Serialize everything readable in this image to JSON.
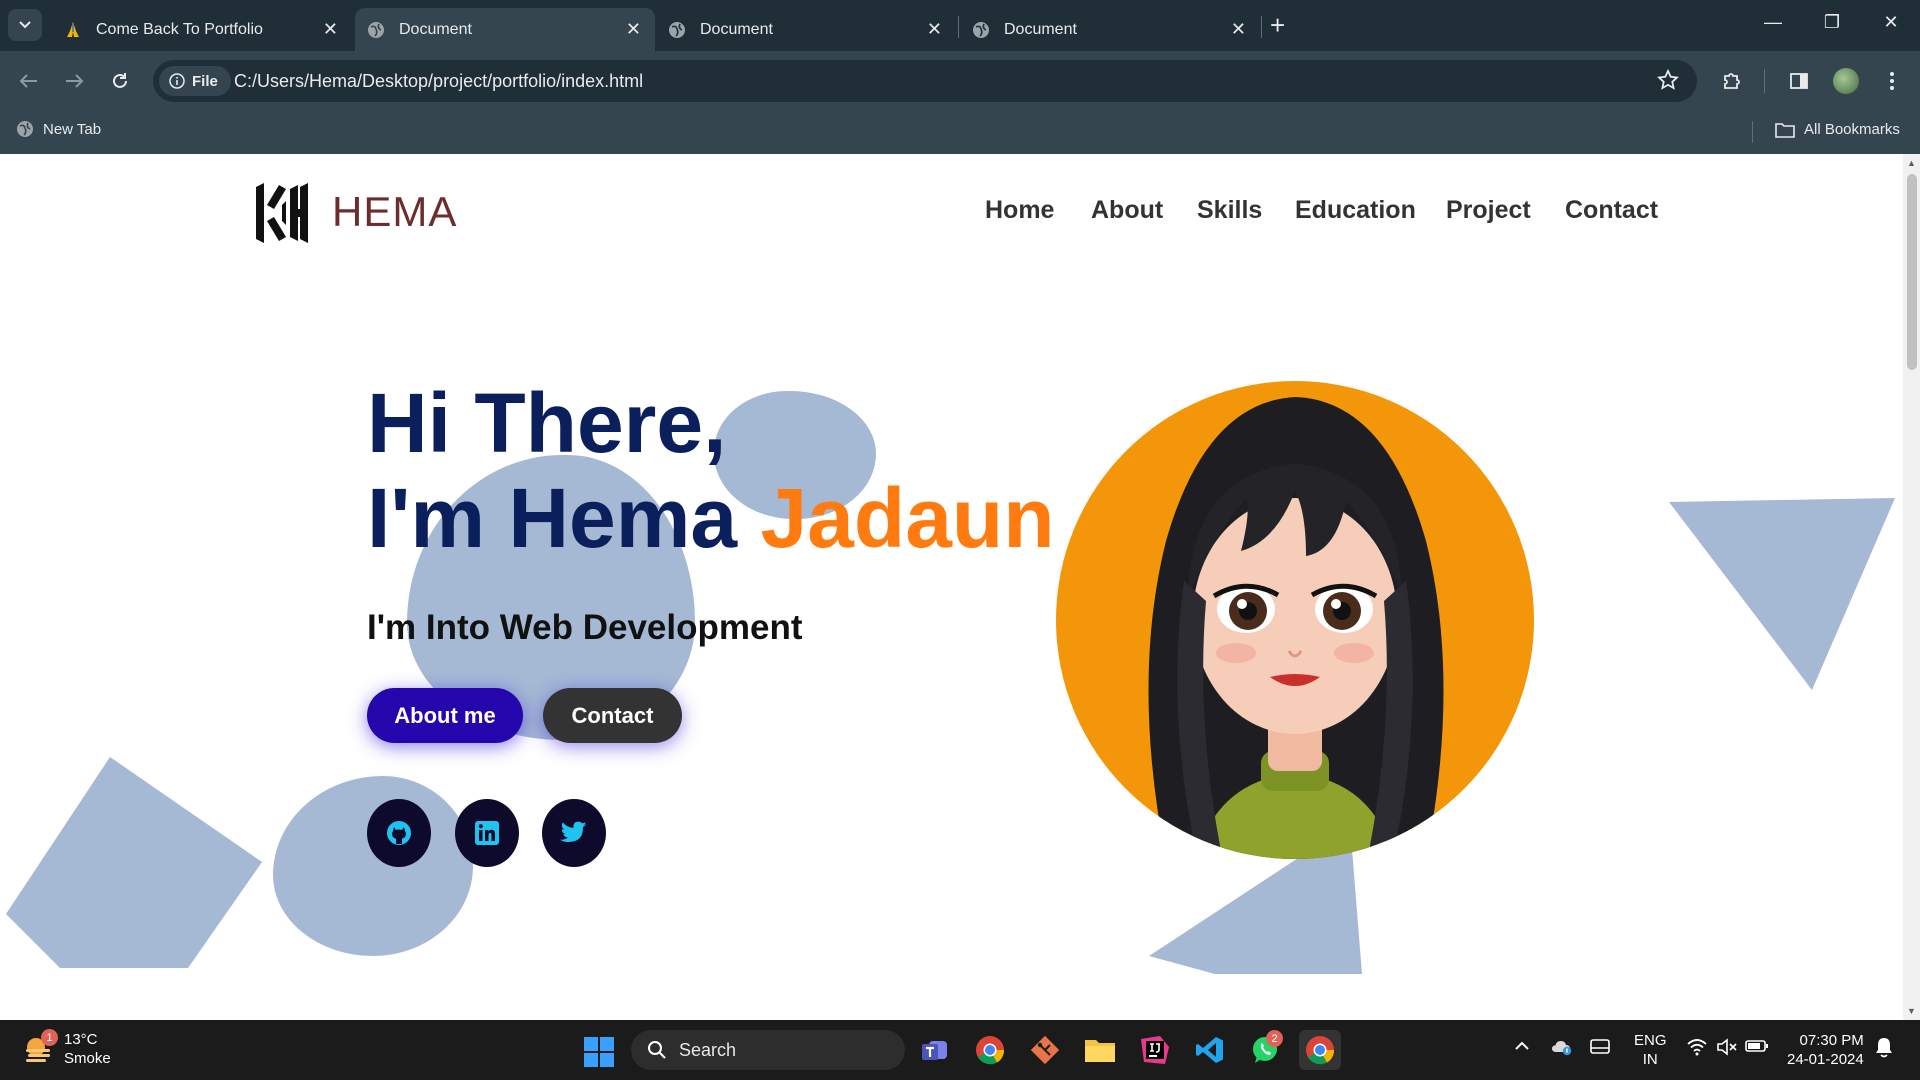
{
  "browser": {
    "tabs": [
      {
        "title": "Come Back To Portfolio",
        "icon": "praying-hands-icon",
        "active": false
      },
      {
        "title": "Document",
        "icon": "globe-icon",
        "active": true
      },
      {
        "title": "Document",
        "icon": "globe-icon",
        "active": false
      },
      {
        "title": "Document",
        "icon": "globe-icon",
        "active": false
      }
    ],
    "address": {
      "scheme_label": "File",
      "url": "C:/Users/Hema/Desktop/project/portfolio/index.html"
    },
    "bookmarks": {
      "new_tab": "New Tab",
      "all_bookmarks": "All Bookmarks"
    }
  },
  "site": {
    "brand": "HEMA",
    "nav": [
      "Home",
      "About",
      "Skills",
      "Education",
      "Project",
      "Contact"
    ],
    "hero": {
      "line1": "Hi There,",
      "line2_prefix": "I'm Hema ",
      "line2_accent": "Jadaun",
      "subtitle": "I'm Into Web Development",
      "btn_about": "About me",
      "btn_contact": "Contact",
      "socials": [
        "github-icon",
        "linkedin-icon",
        "twitter-icon"
      ]
    },
    "colors": {
      "heading": "#0b1f5c",
      "accent": "#ff7a0f",
      "about_btn": "#2506ad",
      "contact_btn": "#333333",
      "blob": "#a5b8d4",
      "portrait_bg": "#f4960a"
    }
  },
  "taskbar": {
    "weather": {
      "temp": "13°C",
      "condition": "Smoke",
      "badge": "1"
    },
    "search_placeholder": "Search",
    "whatsapp_badge": "2",
    "lang_line1": "ENG",
    "lang_line2": "IN",
    "time": "07:30 PM",
    "date": "24-01-2024"
  }
}
